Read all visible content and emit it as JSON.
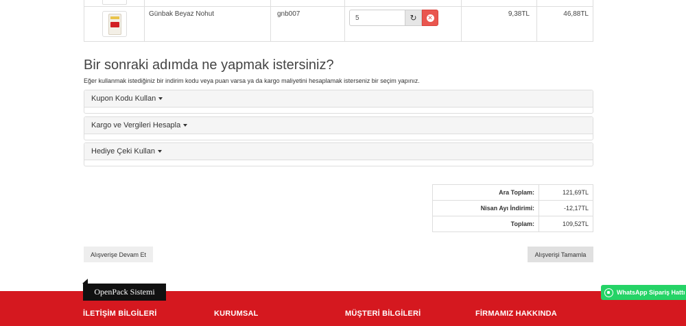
{
  "cart": {
    "row": {
      "product_name": "Günbak Beyaz Nohut",
      "product_code": "gnb007",
      "quantity": "5",
      "unit_price": "9,38TL",
      "total_price": "46,88TL"
    }
  },
  "next_steps": {
    "heading": "Bir sonraki adımda ne yapmak istersiniz?",
    "intro": "Eğer kullanmak istediğiniz bir indirim kodu veya puan varsa ya da kargo maliyetini hesaplamak isterseniz bir seçim yapınız.",
    "panels": [
      {
        "label": "Kupon Kodu Kullan"
      },
      {
        "label": "Kargo ve Vergileri Hesapla"
      },
      {
        "label": "Hediye Çeki Kullan"
      }
    ]
  },
  "totals": [
    {
      "label": "Ara Toplam:",
      "value": "121,69TL"
    },
    {
      "label": "Nisan Ayı İndirimi:",
      "value": "-12,17TL"
    },
    {
      "label": "Toplam:",
      "value": "109,52TL"
    }
  ],
  "actions": {
    "continue_label": "Alışverişe Devam Et",
    "checkout_label": "Alışverişi Tamamla"
  },
  "footer": {
    "brand": "OpenPack Sistemi",
    "columns": [
      "İLETİŞİM BİLGİLERİ",
      "KURUMSAL",
      "MÜŞTERİ BİLGİLERİ",
      "FİRMAMIZ HAKKINDA"
    ],
    "accent_color": "#d5181f"
  },
  "whatsapp": {
    "label": "WhatsApp Sipariş Hattı",
    "color": "#25d366"
  }
}
